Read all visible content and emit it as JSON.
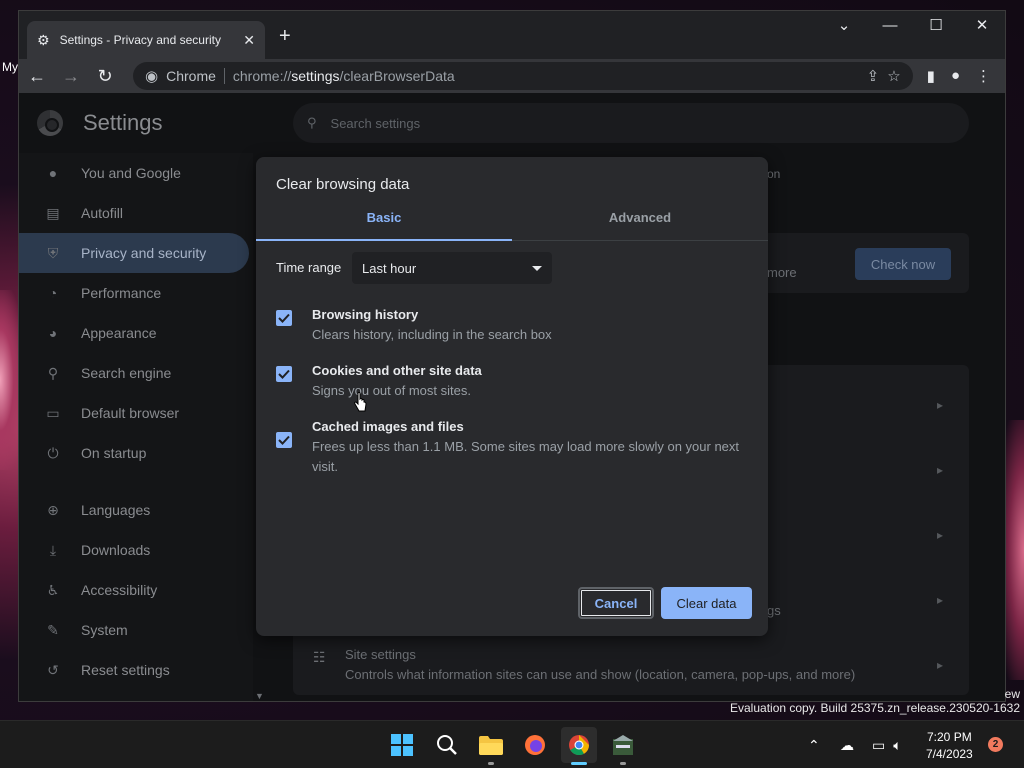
{
  "desktop": {
    "label_fragment": "My"
  },
  "browser": {
    "tab_title": "Settings - Privacy and security",
    "new_tab": "+",
    "window_controls": {
      "minimize": "—",
      "maximize": "☐",
      "close": "✕",
      "dropdown": "⌄"
    },
    "omnibox": {
      "chip": "Chrome",
      "url_prefix": "chrome://",
      "url_host": "settings",
      "url_path": "/clearBrowserData"
    }
  },
  "settings": {
    "title": "Settings",
    "search_placeholder": "Search settings",
    "sidebar": [
      {
        "label": "You and Google",
        "icon": "person-icon"
      },
      {
        "label": "Autofill",
        "icon": "clipboard-icon"
      },
      {
        "label": "Privacy and security",
        "icon": "shield-icon",
        "active": true
      },
      {
        "label": "Performance",
        "icon": "gauge-icon"
      },
      {
        "label": "Appearance",
        "icon": "palette-icon"
      },
      {
        "label": "Search engine",
        "icon": "search-icon"
      },
      {
        "label": "Default browser",
        "icon": "browser-icon"
      },
      {
        "label": "On startup",
        "icon": "power-icon"
      },
      {
        "label": "Languages",
        "icon": "globe-icon"
      },
      {
        "label": "Downloads",
        "icon": "download-icon"
      },
      {
        "label": "Accessibility",
        "icon": "accessibility-icon"
      },
      {
        "label": "System",
        "icon": "wrench-icon"
      },
      {
        "label": "Reset settings",
        "icon": "history-icon"
      }
    ],
    "bg_fragments": {
      "more": "more",
      "check_now": "Check now",
      "gs": "gs",
      "on": "on"
    },
    "site_settings": {
      "title": "Site settings",
      "desc": "Controls what information sites can use and show (location, camera, pop-ups, and more)"
    }
  },
  "dialog": {
    "title": "Clear browsing data",
    "tabs": [
      "Basic",
      "Advanced"
    ],
    "active_tab": "Basic",
    "time_range_label": "Time range",
    "time_range_value": "Last hour",
    "options": [
      {
        "title": "Browsing history",
        "desc": "Clears history, including in the search box",
        "checked": true
      },
      {
        "title": "Cookies and other site data",
        "desc": "Signs you out of most sites.",
        "checked": true
      },
      {
        "title": "Cached images and files",
        "desc": "Frees up less than 1.1 MB. Some sites may load more slowly on your next visit.",
        "checked": true
      }
    ],
    "cancel_label": "Cancel",
    "clear_label": "Clear data"
  },
  "watermark": {
    "line1": "ew",
    "line2": "Evaluation copy. Build 25375.zn_release.230520-1632"
  },
  "taskbar": {
    "time": "7:20 PM",
    "date": "7/4/2023",
    "notifications": "2"
  },
  "colors": {
    "accent": "#8ab4f8",
    "dialog_bg": "#292a2d",
    "active_nav": "#2c3a4e"
  }
}
